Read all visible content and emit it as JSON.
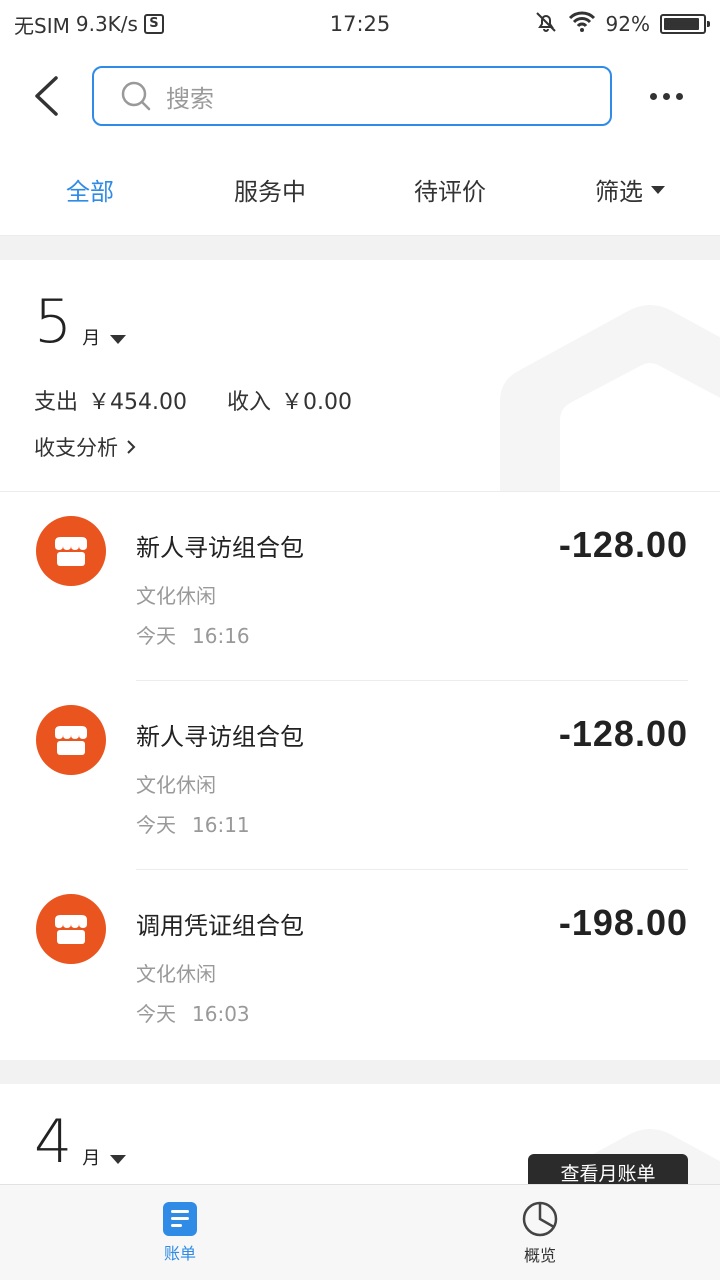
{
  "status_bar": {
    "carrier": "无SIM",
    "speed": "9.3K/s",
    "s_badge": "S",
    "time": "17:25",
    "battery_text": "92%",
    "battery_level": 0.92,
    "icons": [
      "mute-bell-icon",
      "wifi-icon",
      "battery-icon"
    ]
  },
  "header": {
    "search_placeholder": "搜索"
  },
  "tabs": [
    {
      "label": "全部",
      "active": true
    },
    {
      "label": "服务中",
      "active": false
    },
    {
      "label": "待评价",
      "active": false
    },
    {
      "label": "筛选",
      "active": false
    }
  ],
  "month": {
    "number": "5",
    "unit": "月",
    "expense_label": "支出",
    "expense_value": "￥454.00",
    "income_label": "收入",
    "income_value": "￥0.00",
    "analysis_label": "收支分析"
  },
  "transactions": [
    {
      "title": "新人寻访组合包",
      "category": "文化休闲",
      "day": "今天",
      "time": "16:16",
      "amount": "-128.00"
    },
    {
      "title": "新人寻访组合包",
      "category": "文化休闲",
      "day": "今天",
      "time": "16:11",
      "amount": "-128.00"
    },
    {
      "title": "调用凭证组合包",
      "category": "文化休闲",
      "day": "今天",
      "time": "16:03",
      "amount": "-198.00"
    }
  ],
  "next_month": {
    "number": "4",
    "unit": "月",
    "view_bill_label": "查看月账单"
  },
  "bottom_nav": [
    {
      "label": "账单",
      "active": true,
      "icon": "bill-icon"
    },
    {
      "label": "概览",
      "active": false,
      "icon": "pie-chart-icon"
    }
  ],
  "colors": {
    "accent": "#2f8be6",
    "shop_icon": "#e9541f"
  }
}
